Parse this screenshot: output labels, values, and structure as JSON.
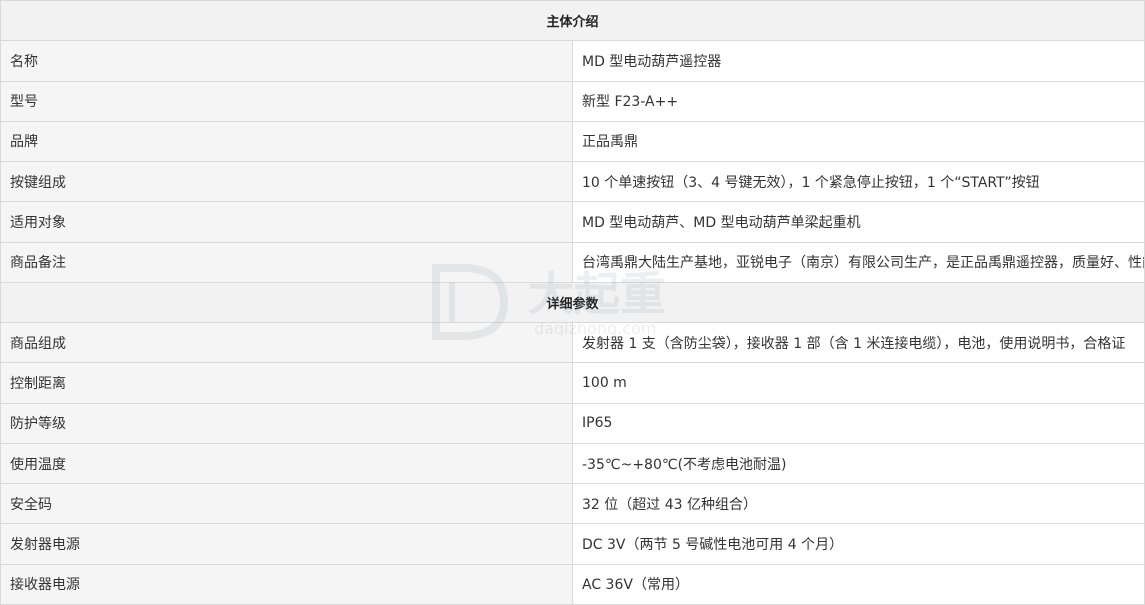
{
  "sections": [
    {
      "title": "主体介绍",
      "rows": [
        {
          "label": "名称",
          "value": "MD 型电动葫芦遥控器"
        },
        {
          "label": "型号",
          "value": "新型 F23-A++"
        },
        {
          "label": "品牌",
          "value": "正品禹鼎"
        },
        {
          "label": "按键组成",
          "value": "10 个单速按钮（3、4 号键无效），1 个紧急停止按钮，1 个“START”按钮"
        },
        {
          "label": "适用对象",
          "value": "MD 型电动葫芦、MD 型电动葫芦单梁起重机"
        },
        {
          "label": "商品备注",
          "value": "台湾禹鼎大陆生产基地，亚锐电子（南京）有限公司生产，是正品禹鼎遥控器，质量好、性能稳定。"
        }
      ]
    },
    {
      "title": "详细参数",
      "rows": [
        {
          "label": "商品组成",
          "value": "发射器 1 支（含防尘袋），接收器 1 部（含 1 米连接电缆），电池，使用说明书，合格证"
        },
        {
          "label": "控制距离",
          "value": "100 m"
        },
        {
          "label": "防护等级",
          "value": "IP65"
        },
        {
          "label": "使用温度",
          "value": "-35℃~+80℃(不考虑电池耐温)"
        },
        {
          "label": "安全码",
          "value": "32 位（超过 43 亿种组合）"
        },
        {
          "label": "发射器电源",
          "value": "DC 3V（两节 5 号碱性电池可用 4 个月）"
        },
        {
          "label": "接收器电源",
          "value": "AC 36V（常用）"
        }
      ]
    }
  ],
  "watermark": {
    "brand": "大起重",
    "domain": "daqizhong.com",
    "color": "#9aa3ad"
  }
}
